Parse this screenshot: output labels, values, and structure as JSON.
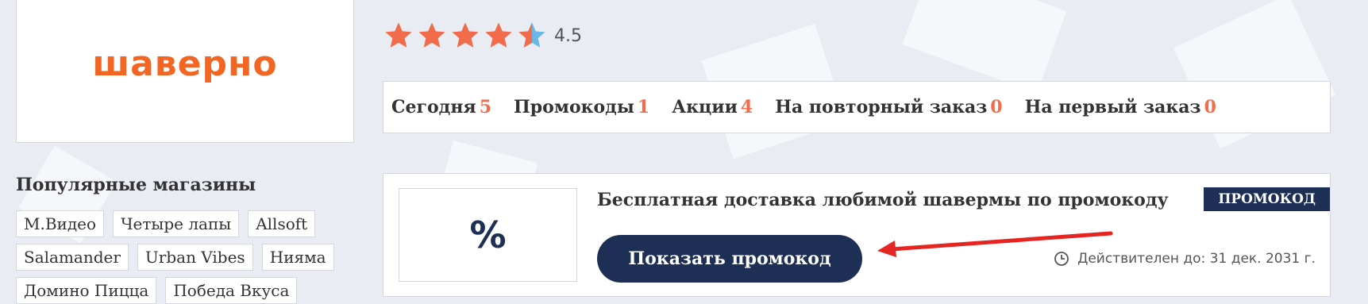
{
  "brand": {
    "logo_text": "шаверно",
    "logo_color": "#f26522"
  },
  "rating": {
    "value": "4.5",
    "stars": 4.5,
    "star_color": "#f26b4a",
    "half_color": "#6ab7e6"
  },
  "counters": [
    {
      "label": "Сегодня",
      "count": "5"
    },
    {
      "label": "Промокоды",
      "count": "1"
    },
    {
      "label": "Акции",
      "count": "4"
    },
    {
      "label": "На повторный заказ",
      "count": "0"
    },
    {
      "label": "На первый заказ",
      "count": "0"
    }
  ],
  "popular": {
    "title": "Популярные магазины",
    "rows": [
      [
        "М.Видео",
        "Четыре лапы",
        "Allsoft"
      ],
      [
        "Salamander",
        "Urban Vibes",
        "Нияма"
      ],
      [
        "Домино Пицца",
        "Победа Вкуса"
      ]
    ]
  },
  "coupon": {
    "image_text": "%",
    "title": "Бесплатная доставка любимой шавермы по промокоду",
    "badge": "ПРОМОКОД",
    "button_label": "Показать промокод",
    "valid_text": "Действителен до: 31 дек. 2031 г.",
    "icon": "clock-icon",
    "arrow_color": "#e52521"
  },
  "colors": {
    "navy": "#1e2f55",
    "accent": "#f26b4a",
    "background": "#e9edf3"
  }
}
